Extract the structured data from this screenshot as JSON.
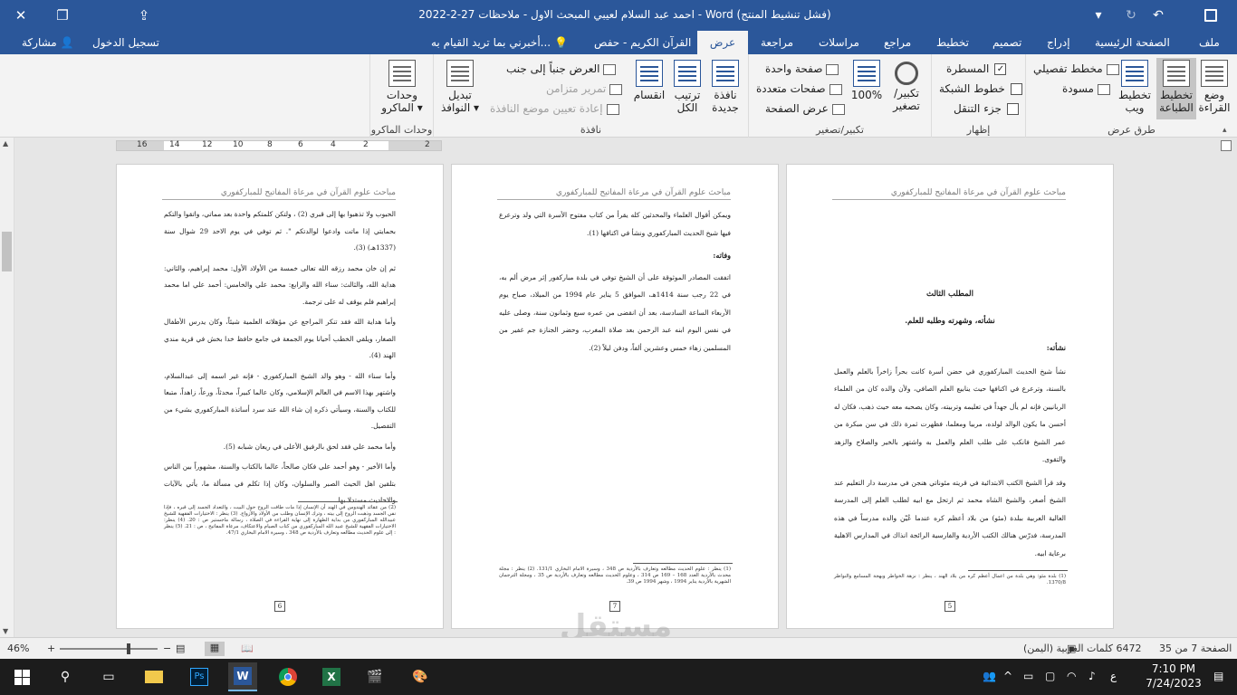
{
  "window": {
    "title": "احمد عبد السلام لعيبي المبحث الاول - ملاحظات 27-2-2022 - Word (فشل تنشيط المنتج)",
    "close_icon": "✕",
    "restore_icon": "❐",
    "ribbon_display_icon": "⇪",
    "minimize_icon": "—"
  },
  "quick_access": {
    "save_icon": "💾",
    "undo_icon": "↶",
    "redo_icon": "↻",
    "customize_icon": "▾"
  },
  "tabs": {
    "file": "ملف",
    "home": "الصفحة الرئيسية",
    "insert": "إدراج",
    "design": "تصميم",
    "layout": "تخطيط",
    "references": "مراجع",
    "mailings": "مراسلات",
    "review": "مراجعة",
    "view": "عرض",
    "quran": "القرآن الكريم - حفص",
    "tell_me": "أخبرني بما تريد القيام به...",
    "sign_in": "تسجيل الدخول",
    "share": "مشاركة"
  },
  "ribbon": {
    "views": {
      "label": "طرق عرض",
      "read_mode": "وضع القراءة",
      "print_layout": "تخطيط الطباعة",
      "web_layout": "تخطيط ويب",
      "outline": "مخطط تفصيلي",
      "draft": "مسودة"
    },
    "show": {
      "label": "إظهار",
      "ruler": "المسطرة",
      "gridlines": "خطوط الشبكة",
      "nav_pane": "جزء التنقل",
      "ruler_checked": "✓"
    },
    "zoom": {
      "label": "تكبير/تصغير",
      "zoom": "تكبير/ تصغير",
      "hundred": "100%",
      "one_page": "صفحة واحدة",
      "multiple_pages": "صفحات متعددة",
      "page_width": "عرض الصفحة"
    },
    "window": {
      "label": "نافذة",
      "new_window": "نافذة جديدة",
      "arrange_all": "ترتيب الكل",
      "split": "انقسام",
      "side_by_side": "العرض جنباً إلى جنب",
      "sync_scroll": "تمرير متزامن",
      "reset_position": "إعادة تعيين موضع النافذة",
      "switch_windows": "تبديل النوافذ"
    },
    "macros": {
      "label": "وحدات الماكرو",
      "macros": "وحدات الماكرو"
    }
  },
  "ruler_numbers": [
    "2",
    "2",
    "4",
    "6",
    "8",
    "10",
    "12",
    "14",
    "16"
  ],
  "pages": [
    {
      "header": "مباحث علوم القرآن في مرعاة المفاتيح للمباركفوري",
      "number": "5",
      "heading1": "المطلب الثالث",
      "heading2": "نشأته، وشهرته وطلبه للعلم.",
      "sub": "نشأته:",
      "p1": "نشأ شيخ الحديث المباركفوري في حضن أسرة كانت بحراً زاخراً بالعلم والعمل بالسنة، وترعرع في اكنافها حيث ينابيع العلم الصافي، ولأن والده كان من العلماء الربانيين فإنه لم يأل جهداً في تعليمه وتربيته، وكان يصحبه معه حيث ذهب، فكان له أحسن ما يكون الوالد لولده، مربيا ومعلما، فظهرت ثمرة ذلك في سن مبكرة من عمر الشيخ فانكب على طلب العلم والعمل به واشتهر بالخير والصلاح والزهد والتقوى.",
      "p2": "وقد قرأ الشيخ الكتب الابتدائية في قريته مئوناتي هنجن في مدرسة دار التعليم عند الشيخ أصغر، والشيخ الشاه محمد ثم ارتحل مع ابيه لطلب العلم إلى المدرسة العالية العربية ببلدة (مئو) من بلاد أعظم كره عندما عُيّن والده مدرساً في هذه المدرسة، فدرّس هنالك الكتب الأردية والفارسية الرائجة انذاك في المدارس الاهلية برعاية ابيه.",
      "fn": "(1) بلدة مئو: وهي بلدة من اعمال أعظم كره من بلاد الهند ، ينظر : نزهة الخواطر وبهجة المسامع والنواظر 1370/8."
    },
    {
      "header": "مباحث علوم القرآن في مرعاة المفاتيح للمباركفوري",
      "number": "7",
      "p1": "ويمكن أقوال العلماء والمحدثين كله يقرأ من كتاب مفتوح الأسرة التي ولد وترعرع فيها شيخ الحديث المباركفوري ونشأ في اكنافها (1).",
      "sub": "وفاته:",
      "p2": "اتفقت المصادر الموثوقة على أن الشيخ توفي في بلدة مباركفور إثر مرض ألم به، في 22 رجب سنة 1414هـ، الموافق 5 يناير عام 1994 من الميلاد، صباح يوم الأربعاء الساعة السادسة، بعد أن انقضى من عمره سبع وثمانون سنة، وصلى عليه في نفس اليوم ابنه عبد الرحمن بعد صلاة المغرب، وحضر الجنازة جم غفير من المسلمين زهاء خمس وعشرين ألفاً، ودفن ليلاً (2).",
      "fn": "(1) ينظر : علوم الحديث مطالعه وتعارف بالأردية ص 348 ، وسيرة الامام البخاري 131/1. (2) ينظر : مجلة محدث بالأردية العدد 168 – 169 ص 314 ، وعلوم الحديث مطالعه وتعارف بالأردية ص 35 ، ومجلة الترجمان الشهرية بالأردية يناير 1994 ، وشهر 1994 ص 39."
    },
    {
      "header": "مباحث علوم القرآن في مرعاة المفاتيح للمباركفوري",
      "number": "6",
      "p1": "الحبوب ولا تذهبوا بها إلى قبري (2) ، ولتكن كلمتكم واحدة بعد مماتي، واتقوا والتكم بحمايتي إذا ماتت وادعوا لوالدتكم \". ثم توفي في يوم الاحد 29 شوال سنة (1337هـ) (3).",
      "p2": "ثم إن خان محمد رزقه الله تعالى خمسة من الأولاد الأول: محمد إبراهيم، والثاني: هداية الله، والثالث: سناء الله والرابع: محمد علي والخامس: أحمد علي اما محمد إبراهيم فلم يوقف له على ترجمة.",
      "p3": "وأما هداية الله فقد تنكر المراجع عن مؤهلاته العلمية شيئاً، وكان يدرس الأطفال الصغار، ويلقي الخطب أحيانا يوم الجمعة في جامع حافظ خدا بخش في قرية مندي الهند (4).",
      "p4": "وأما سناء الله - وهو والد الشيخ المباركفوري - فإنه غير اسمه إلى عبدالسلام، واشتهر بهذا الاسم في العالم الإسلامي، وكان عالما كبيراً، محدثاً، ورعاً، زاهداً، متبعا للكتاب والسنة، وسيأتي ذكره إن شاء الله عند سرد أساتذة المباركفوري بشيء من التفصيل.",
      "p5": "وأما محمد علي فقد لحق بالرفيق الأعلى في ريعان شبابه (5).",
      "p6": "وأما الأخير - وهو أحمد علي فكان صالحاً، عالما بالكتاب والسنة، مشهوراً بين الناس بتلقين اهل الحيث الصبر والسلوان، وكان إذا تكلم في مسألة ما، يأتي بالآيات والاحاديث مستدلا بها.",
      "fn": "(2) من عقائد الهندوس في الهند أن الإنسان إذا مات طافت الروح حول البيت ، والتعداد الجسد إلى قبره ، فإذا نفي الجسد وذهبت الروح إلى بيته ، وترك الإنسان وطلب من الأولاد والأزواج. (3) ينظر : الاختيارات الفقهية للشيخ عبيدالله المباركفوري من بداية الطهارة إلى نهاية القراءة في الصلاة ، رسالة ماجستير ص : 20. (4) ينظر: الاختيارات الفقهية للشيخ عبيد الله المباركفوري من كتاب الصيام والاعتكاف، مرعاة المفاتيح ، ص : 21. (5) ينظر : إلى علوم الحديث مطالعه وتعارف بالأردية ص 348 ، وسيرة الامام البخاري 47/1."
    }
  ],
  "status": {
    "page": "الصفحة 7 من 35",
    "words": "6472 كلمات",
    "language": "العربية (اليمن)",
    "zoom": "46%",
    "zoom_level": 46
  },
  "taskbar": {
    "time": "7:10 PM",
    "date": "7/24/2023",
    "lang": "ع"
  },
  "watermark": {
    "arabic": "مستقل",
    "latin": "mostaql.com"
  }
}
